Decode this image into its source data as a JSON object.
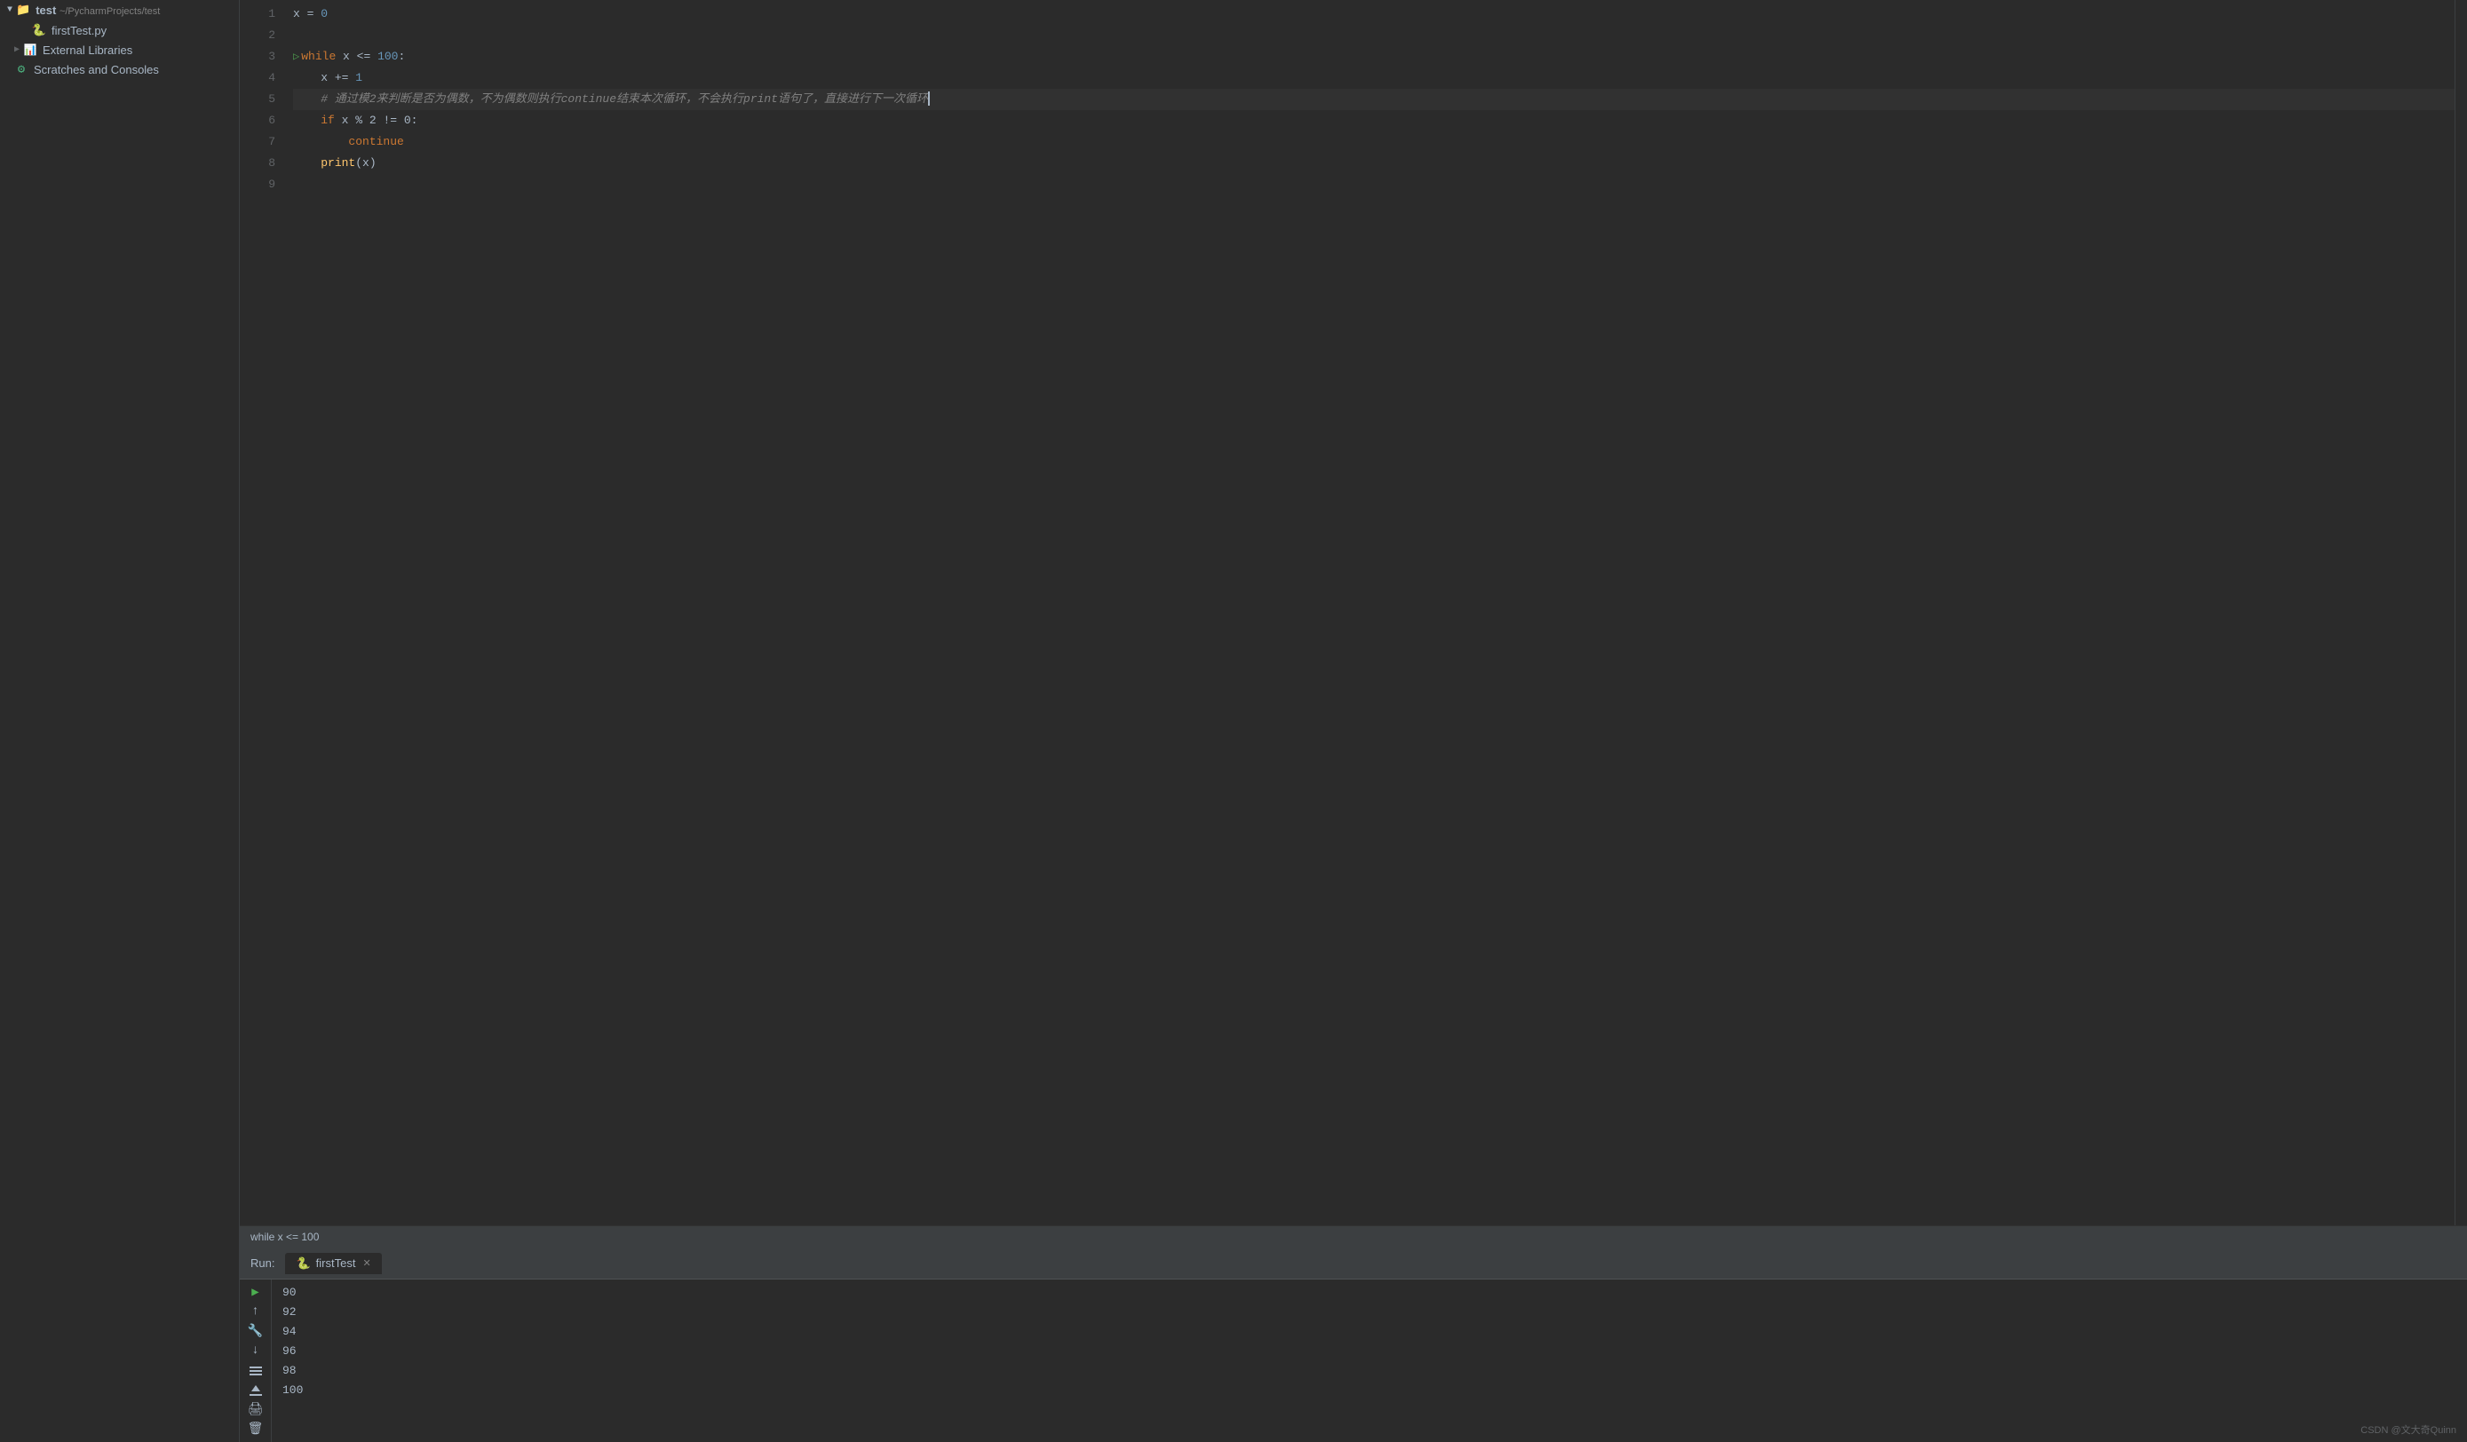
{
  "sidebar": {
    "root": {
      "label": "test",
      "path": "~/PycharmProjects/test",
      "expanded": true
    },
    "items": [
      {
        "id": "firstTest",
        "label": "firstTest.py",
        "type": "file"
      },
      {
        "id": "external-libraries",
        "label": "External Libraries",
        "type": "folder",
        "expanded": false
      },
      {
        "id": "scratches",
        "label": "Scratches and Consoles",
        "type": "scratches"
      }
    ]
  },
  "editor": {
    "filename": "firstTest.py",
    "status_bar": "while x <= 100",
    "lines": [
      {
        "num": 1,
        "content": "x = 0",
        "tokens": [
          {
            "text": "x",
            "cls": "var"
          },
          {
            "text": " = ",
            "cls": "op"
          },
          {
            "text": "0",
            "cls": "num"
          }
        ]
      },
      {
        "num": 2,
        "content": "",
        "tokens": []
      },
      {
        "num": 3,
        "content": "while x <= 100:",
        "tokens": [
          {
            "text": "while",
            "cls": "kw"
          },
          {
            "text": " x ",
            "cls": "var"
          },
          {
            "text": "<=",
            "cls": "op"
          },
          {
            "text": " 100:",
            "cls": "num_punct"
          }
        ]
      },
      {
        "num": 4,
        "content": "    x += 1",
        "tokens": [
          {
            "text": "    x ",
            "cls": "var"
          },
          {
            "text": "+=",
            "cls": "op"
          },
          {
            "text": " 1",
            "cls": "num"
          }
        ]
      },
      {
        "num": 5,
        "content": "    # 通过模2来判断是否为偶数，不为偶数则执行continue结束本次循环，不会执行print语句了，直接进行下一次循环",
        "tokens": [
          {
            "text": "    # 通过模2来判断是否为偶数，不为偶数则执行continue结束本次循环，不会执行print语句了，直接进行下一次循环",
            "cls": "comment"
          }
        ],
        "cursor": true
      },
      {
        "num": 6,
        "content": "    if x % 2 != 0:",
        "tokens": [
          {
            "text": "    ",
            "cls": "plain"
          },
          {
            "text": "if",
            "cls": "kw"
          },
          {
            "text": " x ",
            "cls": "var"
          },
          {
            "text": "%",
            "cls": "op"
          },
          {
            "text": " 2 ",
            "cls": "num"
          },
          {
            "text": "!=",
            "cls": "op"
          },
          {
            "text": " 0:",
            "cls": "num_punct"
          }
        ]
      },
      {
        "num": 7,
        "content": "        continue",
        "tokens": [
          {
            "text": "        ",
            "cls": "plain"
          },
          {
            "text": "continue",
            "cls": "kw"
          }
        ]
      },
      {
        "num": 8,
        "content": "    print(x)",
        "tokens": [
          {
            "text": "    ",
            "cls": "plain"
          },
          {
            "text": "print",
            "cls": "fn"
          },
          {
            "text": "(x)",
            "cls": "plain"
          }
        ],
        "breakpoint": true
      },
      {
        "num": 9,
        "content": "",
        "tokens": []
      }
    ]
  },
  "run_panel": {
    "label": "Run:",
    "tab_label": "firstTest",
    "output": [
      "90",
      "92",
      "94",
      "96",
      "98",
      "100"
    ]
  },
  "toolbar": {
    "buttons": [
      {
        "id": "run",
        "icon": "▶",
        "tooltip": "Run",
        "active": true
      },
      {
        "id": "up",
        "icon": "↑",
        "tooltip": "Up"
      },
      {
        "id": "settings",
        "icon": "🔧",
        "tooltip": "Settings"
      },
      {
        "id": "down",
        "icon": "↓",
        "tooltip": "Down"
      },
      {
        "id": "split",
        "icon": "⋮",
        "tooltip": "Split"
      },
      {
        "id": "scroll-end",
        "icon": "⤓",
        "tooltip": "Scroll to end"
      },
      {
        "id": "print",
        "icon": "🖨",
        "tooltip": "Print"
      },
      {
        "id": "delete",
        "icon": "🗑",
        "tooltip": "Delete"
      }
    ]
  },
  "watermark": "CSDN @文大奇Quinn"
}
